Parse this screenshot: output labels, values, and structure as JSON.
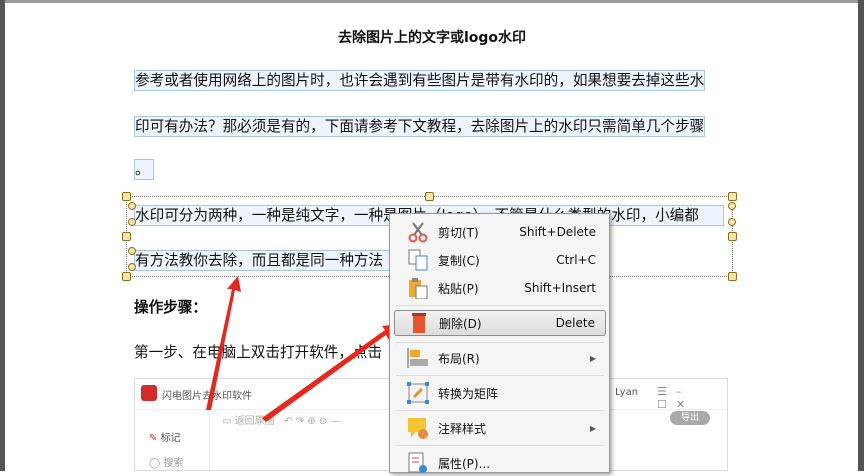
{
  "document": {
    "title": "去除图片上的文字或logo水印",
    "para1_line1": "参考或者使用网络上的图片时，也许会遇到有些图片是带有水印的，如果想要去掉这些水",
    "para1_line2": "印可有办法？那必须是有的，下面请参考下文教程，去除图片上的水印只需简单几个步骤",
    "para1_line3": "。",
    "para2_line1": "水印可分为两种，一种是纯文字，一种是图片（logo），不管是什么类型的水印，小编都",
    "para2_line2": "有方法教你去除，而且都是同一种方法",
    "steps_heading": "操作步骤：",
    "step1": "第一步、在电脑上双击打开软件，点击"
  },
  "embedded_app": {
    "title": "闪电图片去水印软件",
    "user": "Lyan",
    "back_label": "返回原图",
    "export_label": "导出",
    "side_items": [
      "标记",
      "搜索"
    ]
  },
  "context_menu": {
    "items": [
      {
        "label": "剪切(T)",
        "shortcut": "Shift+Delete",
        "icon": "scissors-icon"
      },
      {
        "label": "复制(C)",
        "shortcut": "Ctrl+C",
        "icon": "copy-icon"
      },
      {
        "label": "粘贴(P)",
        "shortcut": "Shift+Insert",
        "icon": "paste-icon"
      },
      {
        "label": "删除(D)",
        "shortcut": "Delete",
        "icon": "trash-icon",
        "highlighted": true
      },
      {
        "label": "布局(R)",
        "submenu": true,
        "icon": "layout-icon"
      },
      {
        "label": "转换为矩阵",
        "icon": "convert-icon"
      },
      {
        "label": "注释样式",
        "submenu": true,
        "icon": "annotation-style-icon"
      },
      {
        "label": "属性(P)...",
        "icon": "properties-icon"
      }
    ]
  },
  "colors": {
    "arrow": "#e8261c",
    "selection": "#eef4fb",
    "trash": "#e8552b"
  }
}
